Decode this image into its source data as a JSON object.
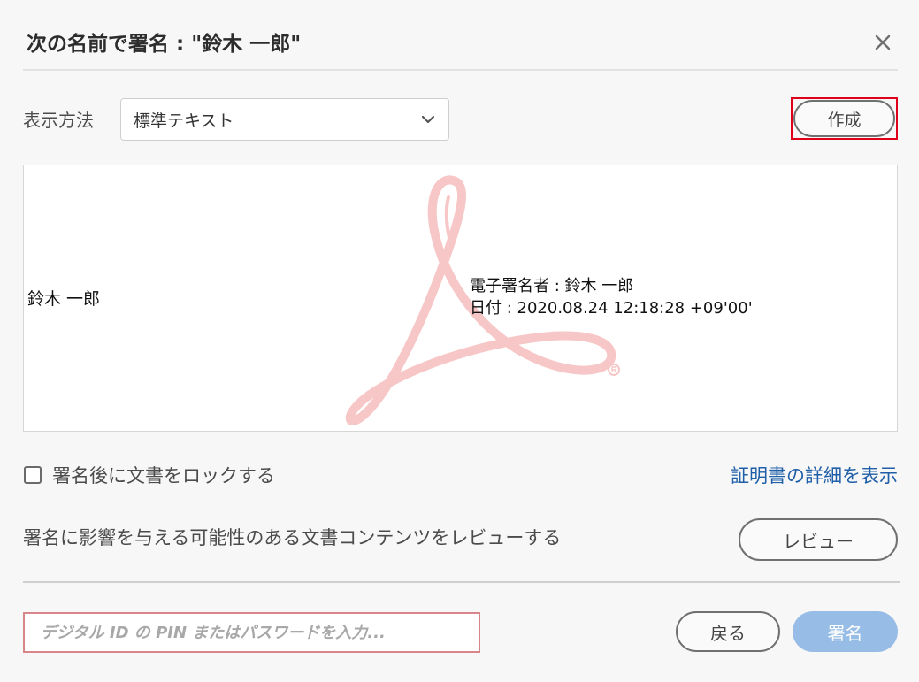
{
  "dialog": {
    "title": "次の名前で署名 : \"鈴木 一郎\""
  },
  "appearance": {
    "label": "表示方法",
    "selected": "標準テキスト",
    "create_label": "作成"
  },
  "preview": {
    "name": "鈴木 一郎",
    "signer_line": "電子署名者 : 鈴木 一郎",
    "date_line": "日付 : 2020.08.24 12:18:28 +09'00'",
    "watermark": "Adobe Acrobat logo"
  },
  "options": {
    "lock_label": "署名後に文書をロックする",
    "lock_checked": false,
    "cert_link": "証明書の詳細を表示",
    "review_text": "署名に影響を与える可能性のある文書コンテンツをレビューする",
    "review_label": "レビュー"
  },
  "footer": {
    "pin_placeholder": "デジタル ID の PIN またはパスワードを入力...",
    "pin_value": "",
    "back_label": "戻る",
    "sign_label": "署名"
  },
  "colors": {
    "highlight": "#e1001a",
    "link": "#1f5fa8",
    "primary_disabled": "#97bde6",
    "watermark": "#f7c6c6"
  },
  "icons": {
    "close": "close-icon",
    "dropdown": "chevron-down-icon",
    "checkbox": "checkbox-icon",
    "watermark": "acrobat-logo-icon"
  }
}
